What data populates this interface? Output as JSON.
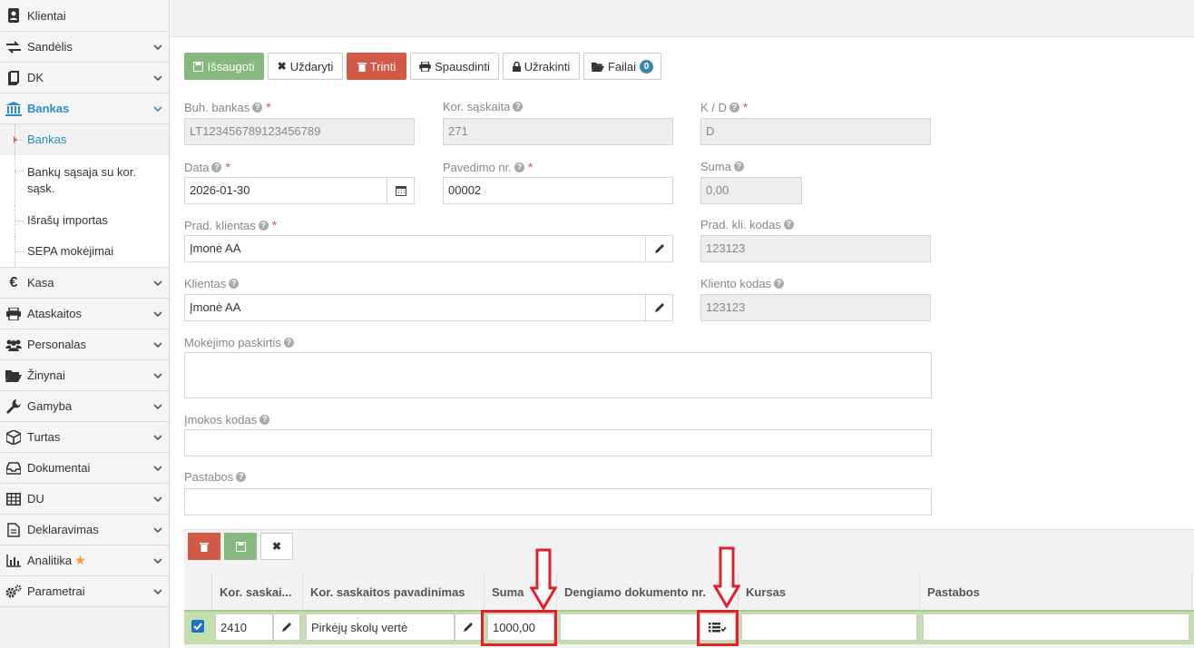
{
  "sidebar": {
    "items": [
      {
        "label": "Klientai",
        "icon": "contacts-icon",
        "chevron": false
      },
      {
        "label": "Sandėlis",
        "icon": "exchange-icon",
        "chevron": true
      },
      {
        "label": "DK",
        "icon": "book-icon",
        "chevron": true
      },
      {
        "label": "Bankas",
        "icon": "bank-icon",
        "chevron": true,
        "active": true
      },
      {
        "label": "Kasa",
        "icon": "euro-icon",
        "chevron": true
      },
      {
        "label": "Ataskaitos",
        "icon": "print-icon",
        "chevron": true
      },
      {
        "label": "Personalas",
        "icon": "users-icon",
        "chevron": true
      },
      {
        "label": "Žinynai",
        "icon": "folder-open-icon",
        "chevron": true
      },
      {
        "label": "Gamyba",
        "icon": "wrench-icon",
        "chevron": true
      },
      {
        "label": "Turtas",
        "icon": "cube-icon",
        "chevron": true
      },
      {
        "label": "Dokumentai",
        "icon": "inbox-icon",
        "chevron": true
      },
      {
        "label": "DU",
        "icon": "table-icon",
        "chevron": true
      },
      {
        "label": "Deklaravimas",
        "icon": "file-text-icon",
        "chevron": true
      },
      {
        "label": "Analitika",
        "icon": "bar-chart-icon",
        "chevron": true,
        "star": true
      },
      {
        "label": "Parametrai",
        "icon": "cogs-icon",
        "chevron": true
      }
    ],
    "bankas_sub": [
      "Bankas",
      "Bankų sąsaja su kor. sąsk.",
      "Išrašų importas",
      "SEPA mokėjimai"
    ]
  },
  "toolbar": {
    "save": "Išsaugoti",
    "close": "Uždaryti",
    "delete": "Trinti",
    "print": "Spausdinti",
    "lock": "Užrakinti",
    "files": "Failai",
    "files_count": "0"
  },
  "form": {
    "buh_bankas": {
      "label": "Buh. bankas",
      "value": "LT123456789123456789"
    },
    "kor_saskaita": {
      "label": "Kor. sąskaita",
      "value": "271"
    },
    "kd": {
      "label": "K / D",
      "value": "D"
    },
    "data": {
      "label": "Data",
      "value": "2026-01-30"
    },
    "pavedimo_nr": {
      "label": "Pavedimo nr.",
      "value": "00002"
    },
    "suma": {
      "label": "Suma",
      "value": "0,00"
    },
    "prad_klientas": {
      "label": "Prad. klientas",
      "value": "Įmonė AA"
    },
    "prad_kli_kodas": {
      "label": "Prad. kli. kodas",
      "value": "123123"
    },
    "klientas": {
      "label": "Klientas",
      "value": "Įmonė AA"
    },
    "kliento_kodas": {
      "label": "Kliento kodas",
      "value": "123123"
    },
    "mokejimo_paskirtis": {
      "label": "Mokėjimo paskirtis",
      "value": ""
    },
    "imokos_kodas": {
      "label": "Įmokos kodas",
      "value": ""
    },
    "pastabos": {
      "label": "Pastabos",
      "value": ""
    }
  },
  "grid": {
    "columns": [
      "Kor. saskai...",
      "Kor. saskaitos pavadinimas",
      "Suma",
      "Dengiamo dokumento nr.",
      "Kursas",
      "Pastabos"
    ],
    "row": {
      "kor": "2410",
      "pavadinimas": "Pirkėjų skolų vertė",
      "suma": "1000,00",
      "dok": "",
      "kursas": "",
      "pastabos": ""
    }
  },
  "colors": {
    "accent": "#2a8fc7",
    "green": "#87b87f",
    "red": "#d15b47",
    "highlight": "#e0202a"
  }
}
